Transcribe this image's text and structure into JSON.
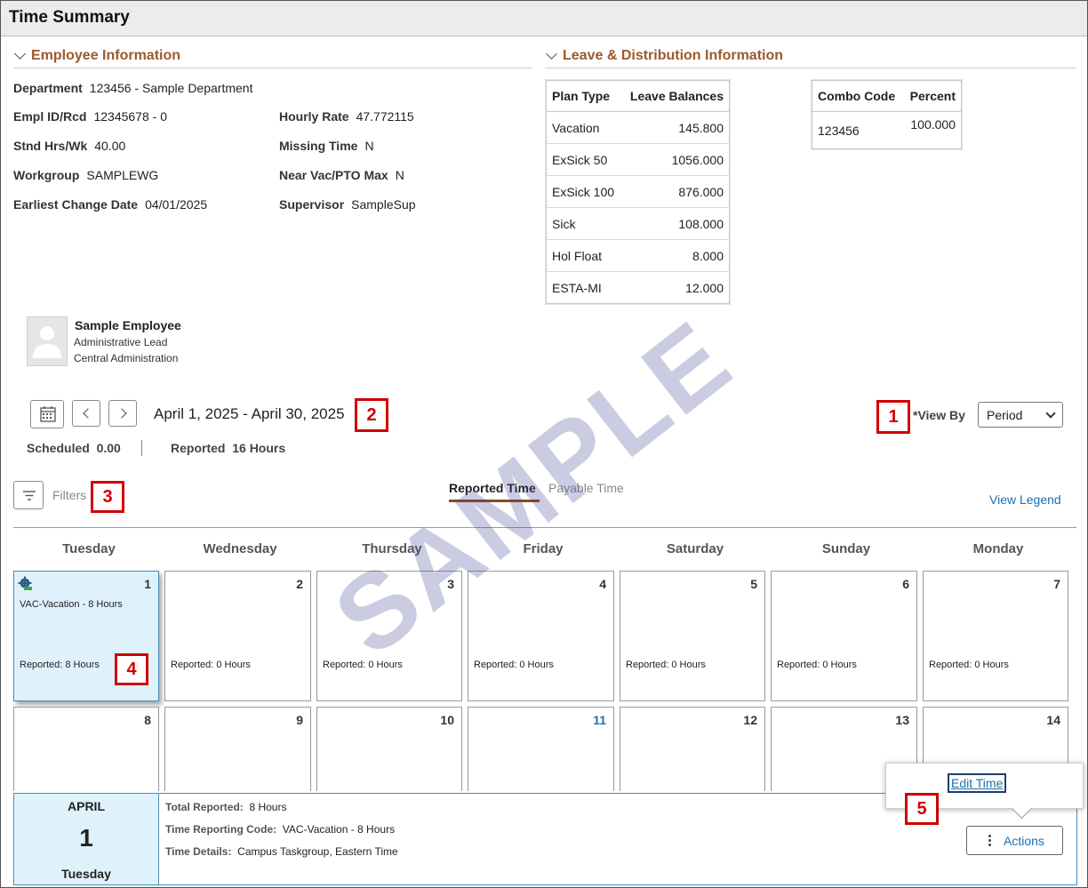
{
  "window": {
    "title": "Time Summary"
  },
  "employee_info": {
    "heading": "Employee Information",
    "department": {
      "label": "Department",
      "value": "123456 - Sample Department"
    },
    "empl_id": {
      "label": "Empl ID/Rcd",
      "value": "12345678 - 0"
    },
    "hourly_rate": {
      "label": "Hourly Rate",
      "value": "47.772115"
    },
    "stnd_hrs": {
      "label": "Stnd Hrs/Wk",
      "value": "40.00"
    },
    "missing_time": {
      "label": "Missing Time",
      "value": "N"
    },
    "workgroup": {
      "label": "Workgroup",
      "value": "SAMPLEWG"
    },
    "near_vac": {
      "label": "Near Vac/PTO Max",
      "value": "N"
    },
    "earliest_change": {
      "label": "Earliest Change Date",
      "value": "04/01/2025"
    },
    "supervisor": {
      "label": "Supervisor",
      "value": "SampleSup"
    }
  },
  "leave_info": {
    "heading": "Leave & Distribution Information",
    "balances_headers": [
      "Plan Type",
      "Leave Balances"
    ],
    "balances": [
      {
        "plan": "Vacation",
        "balance": "145.800"
      },
      {
        "plan": "ExSick 50",
        "balance": "1056.000"
      },
      {
        "plan": "ExSick 100",
        "balance": "876.000"
      },
      {
        "plan": "Sick",
        "balance": "108.000"
      },
      {
        "plan": "Hol Float",
        "balance": "8.000"
      },
      {
        "plan": "ESTA-MI",
        "balance": "12.000"
      }
    ],
    "combo_headers": [
      "Combo Code",
      "Percent"
    ],
    "combo": [
      {
        "code": "123456",
        "percent": "100.000"
      }
    ]
  },
  "employee_card": {
    "name": "Sample Employee",
    "title": "Administrative Lead",
    "dept": "Central Administration"
  },
  "period": {
    "range": "April 1, 2025 - April 30, 2025",
    "scheduled_label": "Scheduled",
    "scheduled_value": "0.00",
    "reported_label": "Reported",
    "reported_value": "16 Hours"
  },
  "view_by": {
    "label": "*View By",
    "selected": "Period"
  },
  "filters": {
    "label": "Filters"
  },
  "tabs": {
    "active": "Reported Time",
    "inactive": "Payable Time"
  },
  "view_legend": "View Legend",
  "watermark": "SAMPLE",
  "weekdays": [
    "Tuesday",
    "Wednesday",
    "Thursday",
    "Friday",
    "Saturday",
    "Sunday",
    "Monday"
  ],
  "week1": [
    {
      "day": "1",
      "entry": "VAC-Vacation - 8 Hours",
      "reported": "Reported: 8 Hours"
    },
    {
      "day": "2",
      "reported": "Reported: 0 Hours"
    },
    {
      "day": "3",
      "reported": "Reported: 0 Hours"
    },
    {
      "day": "4",
      "reported": "Reported: 0 Hours"
    },
    {
      "day": "5",
      "reported": "Reported: 0 Hours"
    },
    {
      "day": "6",
      "reported": "Reported: 0 Hours"
    },
    {
      "day": "7",
      "reported": "Reported: 0 Hours"
    }
  ],
  "week2": [
    "8",
    "9",
    "10",
    "11",
    "12",
    "13",
    "14"
  ],
  "detail": {
    "month": "APRIL",
    "day": "1",
    "weekday": "Tuesday",
    "total_label": "Total Reported:",
    "total_value": "8 Hours",
    "trc_label": "Time Reporting Code:",
    "trc_value": "VAC-Vacation - 8 Hours",
    "details_label": "Time Details:",
    "details_value": "Campus Taskgroup, Eastern Time"
  },
  "actions": {
    "button_label": "Actions",
    "menu_item": "Edit Time"
  },
  "callouts": [
    "1",
    "2",
    "3",
    "4",
    "5"
  ],
  "colors": {
    "accent": "#9a5a2c",
    "link": "#1f6fa8",
    "selected_day": "#dff2fb",
    "callout": "#d00000"
  }
}
